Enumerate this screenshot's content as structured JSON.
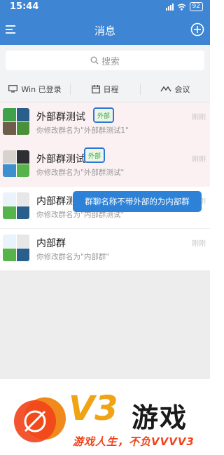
{
  "status_bar": {
    "time": "15:44",
    "battery": "92"
  },
  "nav": {
    "title": "消息"
  },
  "search": {
    "placeholder": "搜索"
  },
  "quick_bar": {
    "items": [
      {
        "label": "Win 已登录",
        "icon": "monitor-icon"
      },
      {
        "label": "日程",
        "icon": "calendar-icon"
      },
      {
        "label": "会议",
        "icon": "meeting-icon"
      }
    ]
  },
  "chats": [
    {
      "name": "外部群测试",
      "tag": "外部",
      "preview": "你修改群名为\"外部群测试1\"",
      "time": "刚刚"
    },
    {
      "name": "外部群测试",
      "tag": "外部",
      "preview": "你修改群名为\"外部群测试\"",
      "time": "刚刚"
    },
    {
      "name": "内部群测试",
      "preview": "你修改群名为\"内部群测试\"",
      "time": "刚刚"
    },
    {
      "name": "内部群",
      "preview": "你修改群名为\"内部群\"",
      "time": "刚刚"
    }
  ],
  "tooltip": {
    "text": "群聊名称不带外部的为内部群"
  },
  "watermark": {
    "brand": "V3",
    "brand_cn": "游戏",
    "slogan": "游戏人生，不负VVVV3"
  },
  "colors": {
    "primary": "#3e86d4",
    "external_tag": "#45a34a",
    "highlight_border": "#2f76d6",
    "watermark_orange": "#f0a313",
    "watermark_red": "#f2421b"
  }
}
